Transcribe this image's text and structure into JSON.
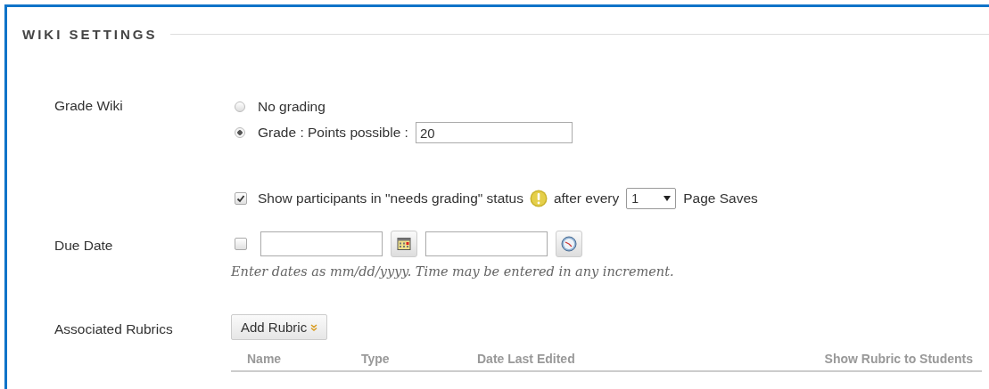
{
  "section_title": "WIKI SETTINGS",
  "grade": {
    "label": "Grade Wiki",
    "options": [
      {
        "label": "No grading",
        "selected": false
      },
      {
        "label": "Grade : Points possible :",
        "selected": true,
        "value": "20"
      }
    ]
  },
  "needs_grading": {
    "checked": true,
    "label_before": "Show participants in \"needs grading\" status",
    "label_after": "after every",
    "select_value": "1",
    "label_end": "Page Saves"
  },
  "due_date": {
    "label": "Due Date",
    "checked": false,
    "hint": "Enter dates as mm/dd/yyyy. Time may be entered in any increment."
  },
  "rubrics": {
    "label": "Associated Rubrics",
    "button": "Add Rubric",
    "columns": [
      "Name",
      "Type",
      "Date Last Edited",
      "Show Rubric to Students"
    ]
  }
}
